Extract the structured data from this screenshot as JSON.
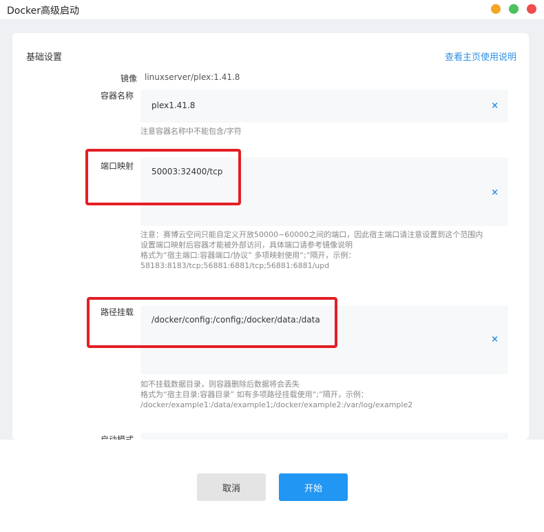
{
  "window": {
    "title": "Docker高级启动"
  },
  "section": {
    "title": "基础设置",
    "help_link": "查看主页使用说明"
  },
  "image_row": {
    "label": "镜像",
    "value": "linuxserver/plex:1.41.8"
  },
  "container_name": {
    "label": "容器名称",
    "value": "plex1.41.8",
    "hint": "注意容器名称中不能包含/字符"
  },
  "port_mapping": {
    "label": "端口映射",
    "value": "50003:32400/tcp",
    "hints": [
      "注意：赛博云空间只能自定义开放50000~60000之间的端口，因此宿主端口请注意设置到这个范围内",
      "设置端口映射后容器才能被外部访问，具体端口请参考镜像说明",
      "格式为“宿主端口:容器端口/协议” 多项映射使用“;”隔开，示例：",
      "58183:8183/tcp;56881:6881/tcp;56881:6881/upd"
    ]
  },
  "path_mount": {
    "label": "路径挂载",
    "value": "/docker/config:/config;/docker/data:/data",
    "hints": [
      "如不挂载数据目录，则容器删除后数据将会丢失",
      "格式为“宿主目录:容器目录” 如有多项路径挂载使用“;”隔开，示例：",
      "/docker/example1:/data/example1;/docker/example2:/var/log/example2"
    ]
  },
  "start_mode": {
    "label": "启动模式"
  },
  "footer": {
    "cancel_label": "取消",
    "start_label": "开始"
  },
  "colors": {
    "accent": "#2196f3",
    "link": "#2d8fe3",
    "highlight": "#e41e25"
  },
  "icons": {
    "clear": "×"
  }
}
